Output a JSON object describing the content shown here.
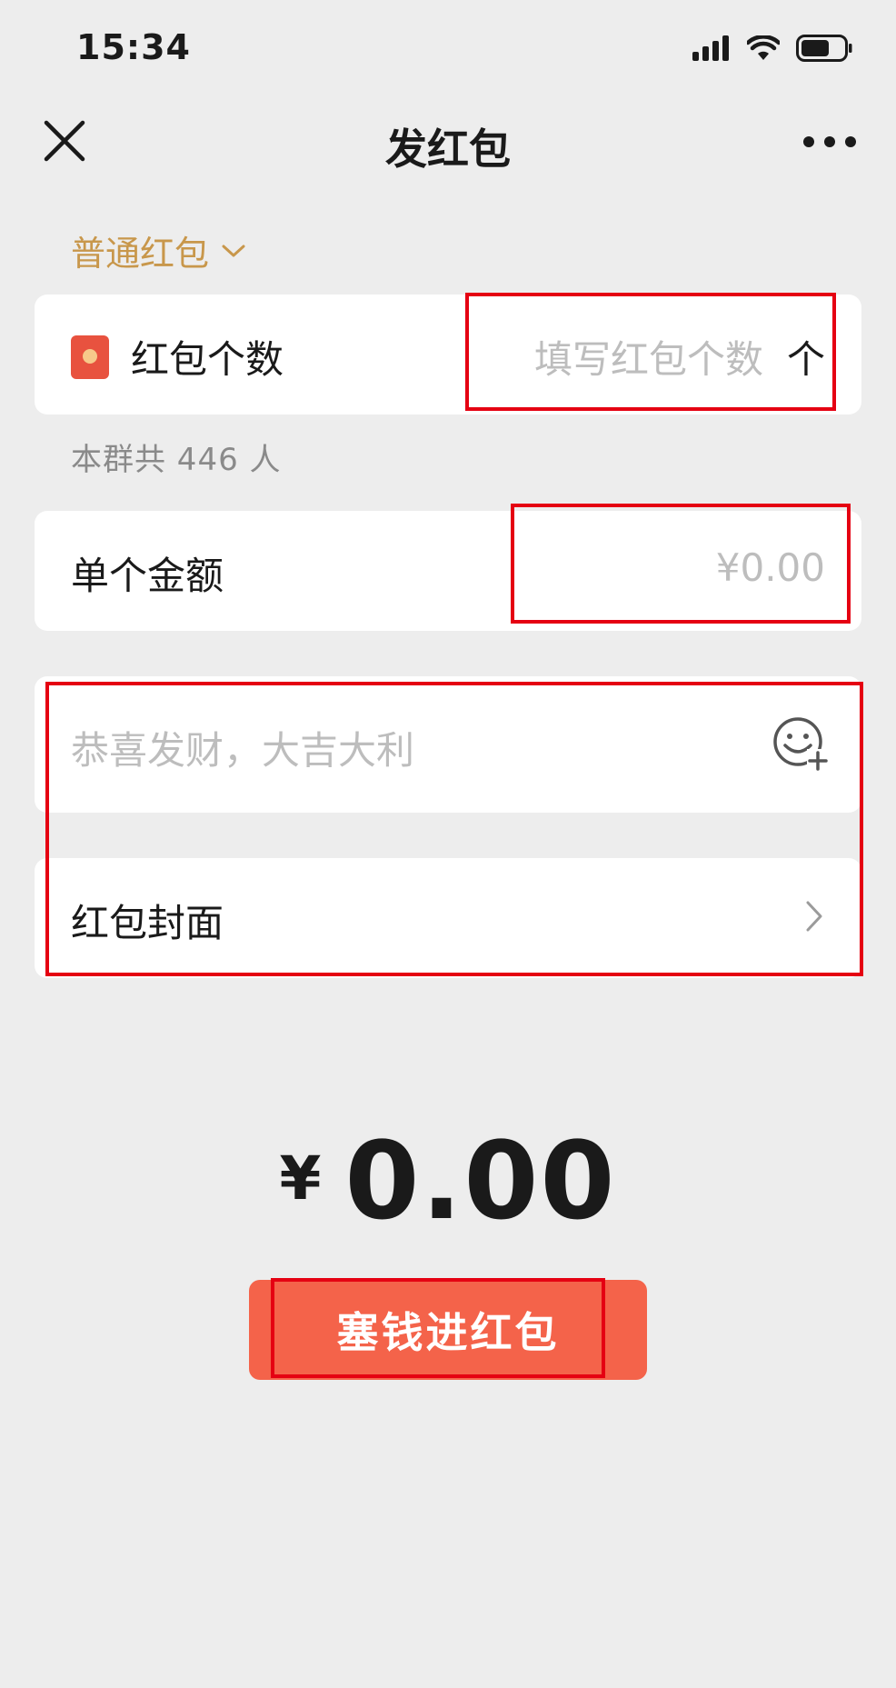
{
  "status_bar": {
    "time": "15:34"
  },
  "nav": {
    "title": "发红包"
  },
  "type_selector": {
    "label": "普通红包"
  },
  "count_row": {
    "label": "红包个数",
    "placeholder": "填写红包个数",
    "unit": "个"
  },
  "group_info": "本群共 446 人",
  "amount_row": {
    "label": "单个金额",
    "placeholder": "¥0.00"
  },
  "greeting": {
    "placeholder": "恭喜发财，大吉大利"
  },
  "cover_row": {
    "label": "红包封面"
  },
  "total": {
    "currency": "¥",
    "value": "0.00"
  },
  "submit": {
    "label": "塞钱进红包"
  },
  "colors": {
    "accent_gold": "#c8974b",
    "button_red": "#f4634a",
    "highlight_red": "#e50012",
    "icon_red": "#e8523f"
  }
}
